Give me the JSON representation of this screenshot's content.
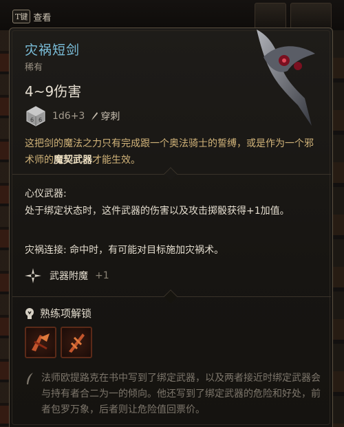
{
  "hint": {
    "key": "T键",
    "label": "查看"
  },
  "item": {
    "name": "灾祸短剑",
    "rarity": "稀有",
    "damage": "4~9伤害",
    "dice": "1d6+3",
    "damage_type": "穿刺",
    "description": [
      {
        "text": "这把剑的魔法之力只有完成跟一个奥法骑士的誓缚，或是作为一个邪术师的",
        "bold": false
      },
      {
        "text": "魔契武器",
        "bold": true
      },
      {
        "text": "才能生效。",
        "bold": false
      }
    ]
  },
  "properties": {
    "pact_title": "心仪武器:",
    "pact_text": "处于绑定状态时，这件武器的伤害以及攻击掷骰获得+1加值。",
    "bane_line": "灾祸连接: 命中时，有可能对目标施加灾祸术。",
    "enchant_label": "武器附魔",
    "enchant_value": "+1"
  },
  "proficiency": {
    "label": "熟练项解锁",
    "skills": [
      "skill-a",
      "skill-b"
    ]
  },
  "lore": "法师欧提路克在书中写到了绑定武器，以及两者接近时绑定武器会与持有者合二为一的倾向。他还写到了绑定武器的危险和好处，前者包罗万象，后者则让危险值回票价。",
  "colors": {
    "title": "#7cc0dc",
    "desc": "#d2b47a",
    "lore": "#7d766b"
  }
}
